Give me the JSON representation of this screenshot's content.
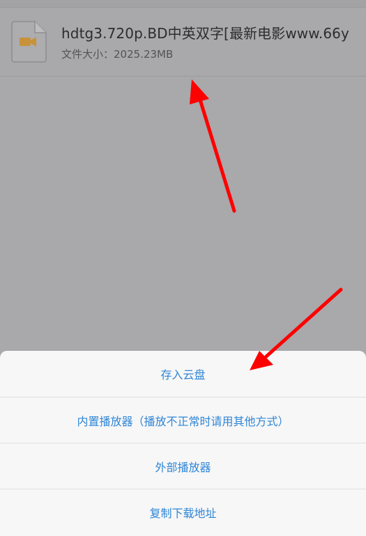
{
  "file": {
    "name": "hdtg3.720p.BD中英双字[最新电影www.66y",
    "size_label": "文件大小：",
    "size_value": "2025.23MB",
    "icon": "video-file-icon"
  },
  "action_sheet": {
    "items": [
      {
        "label": "存入云盘"
      },
      {
        "label": "内置播放器（播放不正常时请用其他方式）"
      },
      {
        "label": "外部播放器"
      },
      {
        "label": "复制下载地址"
      }
    ]
  },
  "colors": {
    "dim_background": "#a9a8aa",
    "sheet_background": "#f7f7f7",
    "action_text": "#2f86d6",
    "annotation_arrow": "#ff0000",
    "icon_accent": "#c8923a"
  }
}
